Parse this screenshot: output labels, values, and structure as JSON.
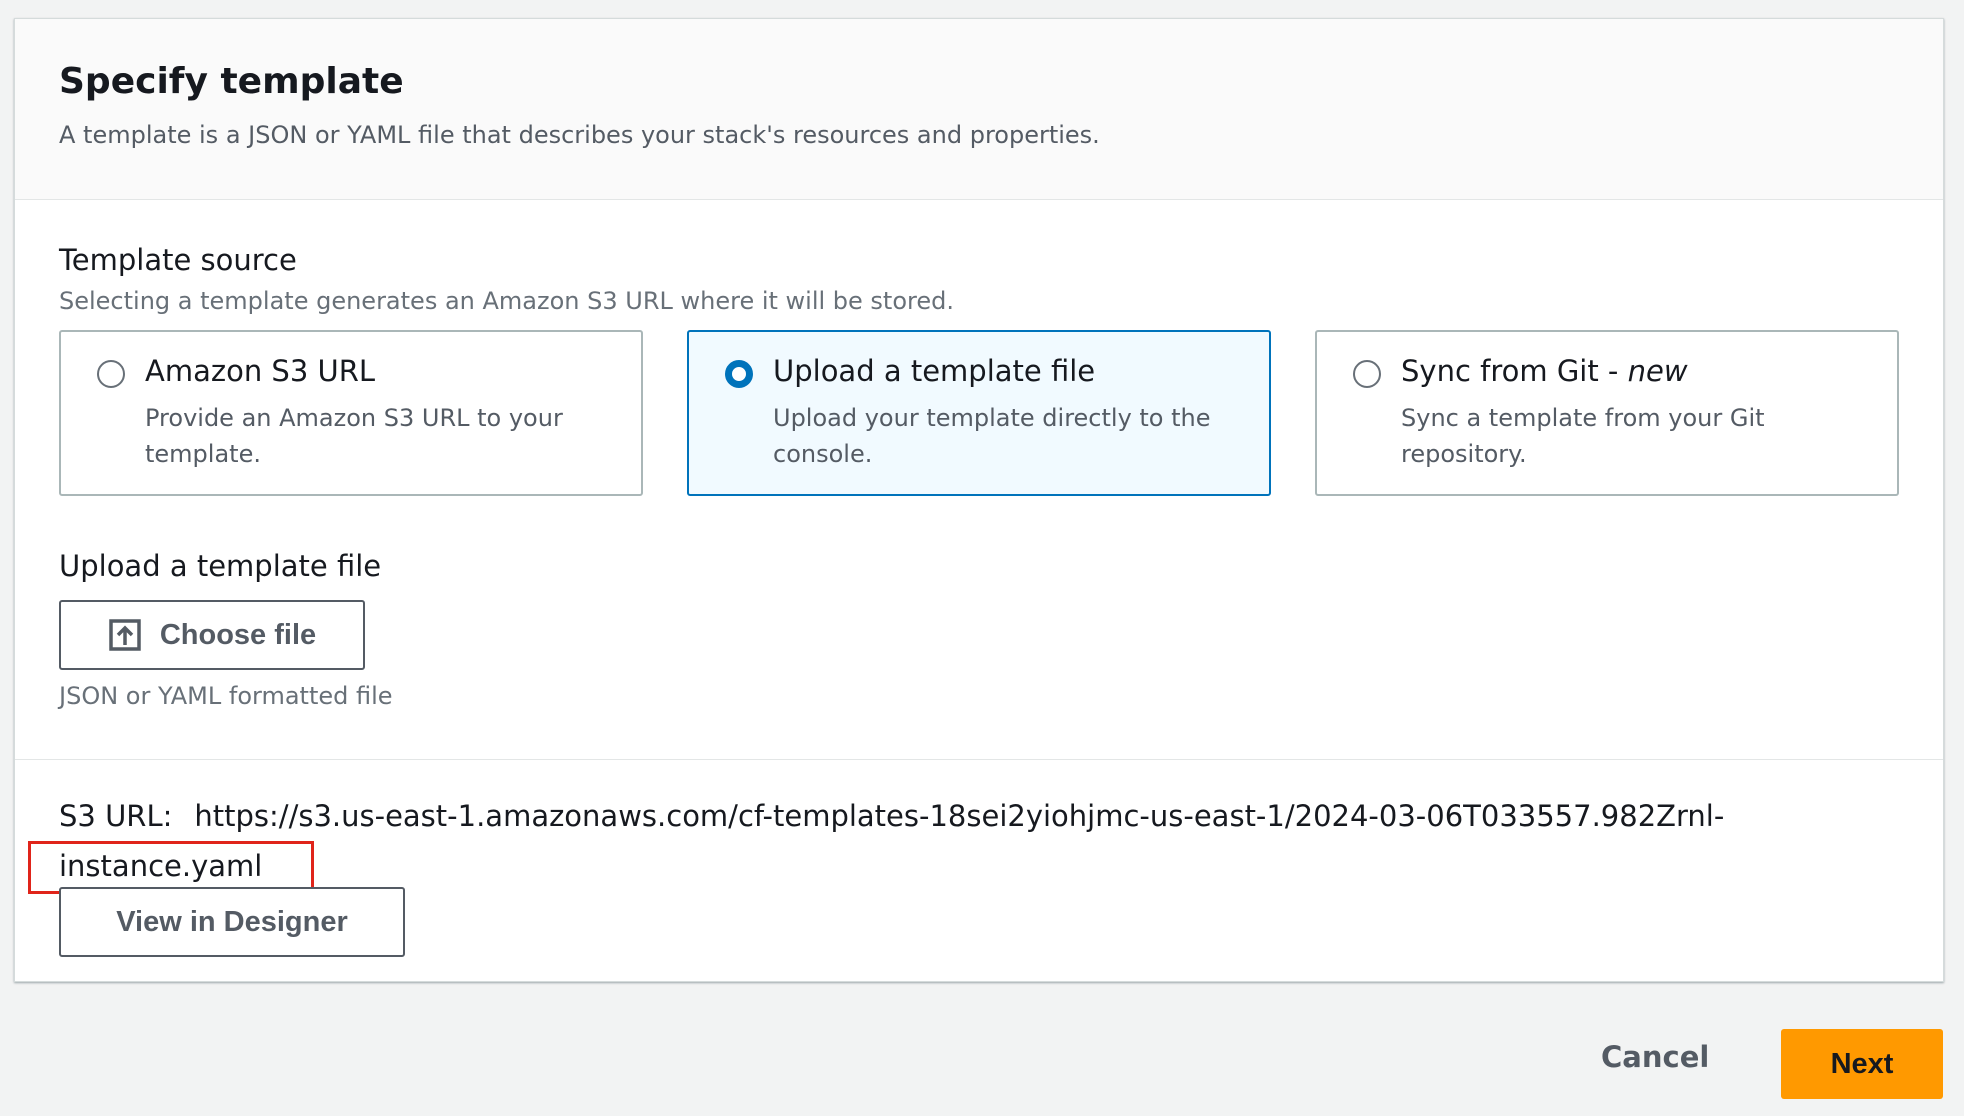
{
  "header": {
    "title": "Specify template",
    "description": "A template is a JSON or YAML file that describes your stack's resources and properties."
  },
  "template_source": {
    "label": "Template source",
    "description": "Selecting a template generates an Amazon S3 URL where it will be stored.",
    "selected": "upload",
    "options": [
      {
        "id": "s3",
        "title": "Amazon S3 URL",
        "description": "Provide an Amazon S3 URL to your template."
      },
      {
        "id": "upload",
        "title": "Upload a template file",
        "description": "Upload your template directly to the console."
      },
      {
        "id": "git",
        "title": "Sync from Git - ",
        "title_badge": "new",
        "description": "Sync a template from your Git repository."
      }
    ]
  },
  "upload": {
    "label": "Upload a template file",
    "choose_button": "Choose file",
    "hint": "JSON or YAML formatted file"
  },
  "s3_url": {
    "label": "S3 URL:",
    "value": "https://s3.us-east-1.amazonaws.com/cf-templates-18sei2yiohjmc-us-east-1/2024-03-06T033557.982Zrnl-instance.yaml"
  },
  "designer_button": "View in Designer",
  "footer": {
    "cancel": "Cancel",
    "next": "Next"
  },
  "colors": {
    "accent": "#0073bb",
    "primary_button": "#ff9900",
    "highlight_box": "#e0241a"
  },
  "icons": {
    "upload": "upload-icon"
  }
}
